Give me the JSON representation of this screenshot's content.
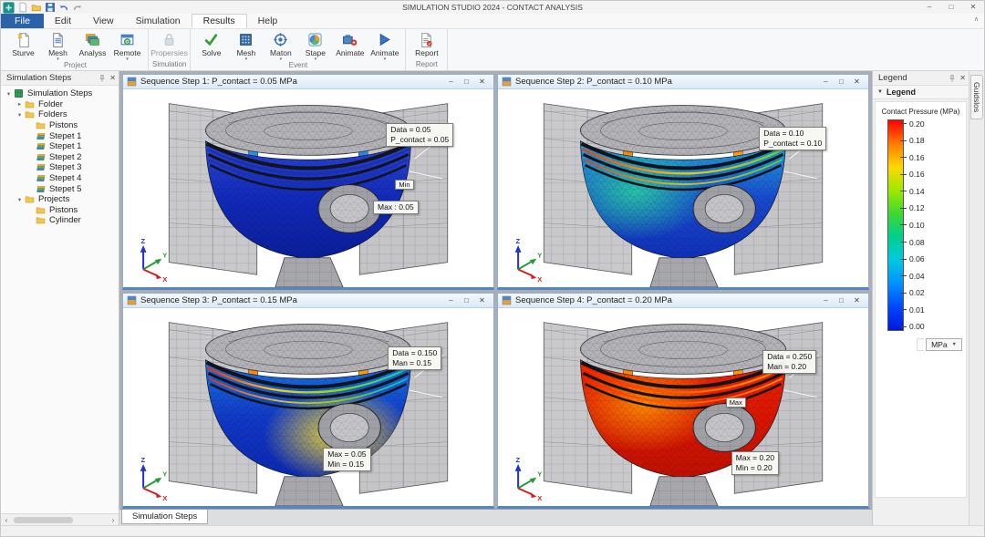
{
  "titlebar": {
    "title": "SIMULATION STUDIO 2024 - CONTACT ANALYSIS",
    "controls": {
      "minimize": "–",
      "maximize": "□",
      "close": "✕"
    },
    "ribbon_collapse": "∧",
    "quick_access": [
      "new",
      "open",
      "save",
      "undo",
      "redo"
    ]
  },
  "menubar": {
    "items": [
      {
        "label": "File"
      },
      {
        "label": "Edit"
      },
      {
        "label": "View"
      },
      {
        "label": "Simulation"
      },
      {
        "label": "Results"
      },
      {
        "label": "Help"
      }
    ],
    "active": "Results"
  },
  "ribbon": {
    "groups": [
      {
        "label": "Project",
        "buttons": [
          {
            "label": "Sturve",
            "icon": "doc-new",
            "dropdown": false
          },
          {
            "label": "Mesh",
            "icon": "doc-mesh",
            "dropdown": true
          },
          {
            "label": "Analyss",
            "icon": "layers",
            "dropdown": false
          },
          {
            "label": "Remote",
            "icon": "window-gear",
            "dropdown": true
          }
        ]
      },
      {
        "label": "Simulation",
        "buttons": [
          {
            "label": "Propersies",
            "icon": "lock",
            "disabled": true
          }
        ]
      },
      {
        "label": "Event",
        "buttons": [
          {
            "label": "Solve",
            "icon": "check"
          },
          {
            "label": "Mesh",
            "icon": "grid",
            "dropdown": true
          },
          {
            "label": "Maton",
            "icon": "target",
            "dropdown": true
          },
          {
            "label": "Stape",
            "icon": "pinwheel",
            "dropdown": true
          },
          {
            "label": "Animate",
            "icon": "machine"
          },
          {
            "label": "Animate",
            "icon": "play",
            "dropdown": true
          }
        ]
      },
      {
        "label": "Report",
        "buttons": [
          {
            "label": "Report",
            "icon": "report"
          }
        ]
      }
    ]
  },
  "sidebar": {
    "title": "Simulation Steps",
    "tree": [
      {
        "label": "Simulation Steps",
        "depth": 0,
        "icon": "root",
        "chev": "open"
      },
      {
        "label": "Folder",
        "depth": 1,
        "icon": "folder",
        "chev": "closed"
      },
      {
        "label": "Folders",
        "depth": 1,
        "icon": "folder",
        "chev": "open"
      },
      {
        "label": "Pistons",
        "depth": 2,
        "icon": "folder",
        "chev": "none"
      },
      {
        "label": "Stepet 1",
        "depth": 2,
        "icon": "step",
        "chev": "none"
      },
      {
        "label": "Stepet 1",
        "depth": 2,
        "icon": "step",
        "chev": "none"
      },
      {
        "label": "Stepet 2",
        "depth": 2,
        "icon": "step",
        "chev": "none"
      },
      {
        "label": "Stepet 3",
        "depth": 2,
        "icon": "step",
        "chev": "none"
      },
      {
        "label": "Stepet 4",
        "depth": 2,
        "icon": "step",
        "chev": "none"
      },
      {
        "label": "Stepet 5",
        "depth": 2,
        "icon": "step",
        "chev": "none"
      },
      {
        "label": "Projects",
        "depth": 1,
        "icon": "folder",
        "chev": "open"
      },
      {
        "label": "Pistons",
        "depth": 2,
        "icon": "folder",
        "chev": "none"
      },
      {
        "label": "Cylinder",
        "depth": 2,
        "icon": "folder",
        "chev": "none"
      }
    ]
  },
  "viewports": [
    {
      "title": "Sequence Step 1: P_contact = 0.05 MPa",
      "annotations": {
        "data1": "Data = 0.05",
        "data2": "P_contact = 0.05",
        "mini": "Min",
        "max1": "Max : 0.05"
      },
      "colors": {
        "strip": [
          "#35b9ef",
          "#1243e4",
          "#0a2ac0"
        ],
        "rings": [
          "#1a2fae"
        ],
        "body": [
          "#2b46d6",
          "#1129ba",
          "#0a1e9a"
        ],
        "glow": null
      }
    },
    {
      "title": "Sequence Step 2: P_contact = 0.10 MPa",
      "annotations": {
        "data1": "Data = 0.10",
        "data2": "P_contact = 0.10"
      },
      "colors": {
        "strip": [
          "#ff3300",
          "#ffd000",
          "#2fc83a",
          "#1140e0"
        ],
        "rings": [
          "#ff3300",
          "#ffc400",
          "#62d822"
        ],
        "body": [
          "#23a9d9",
          "#1848d0",
          "#1030b8"
        ],
        "glow": "#27c9a4"
      }
    },
    {
      "title": "Sequence Step 3: P_contact = 0.15 MPa",
      "annotations": {
        "data1": "Data = 0.150",
        "data2": "Man = 0.15",
        "max1": "Max = 0.05",
        "max2": "Min = 0.15"
      },
      "colors": {
        "strip": [
          "#ff3300",
          "#ffd000",
          "#2fc83a",
          "#1140e0"
        ],
        "rings": [
          "#ff2200",
          "#ffcc00",
          "#7fe000",
          "#00c8c8"
        ],
        "body": [
          "#1a78e0",
          "#1038c8",
          "#0c28b0"
        ],
        "glow": "#ffe02c"
      }
    },
    {
      "title": "Sequence Step 4: P_contact = 0.20 MPa",
      "annotations": {
        "data1": "Data = 0.250",
        "data2": "Man = 0.20",
        "mini": "Max",
        "max1": "Max = 0.20",
        "max2": "Min = 0.20"
      },
      "colors": {
        "strip": [
          "#ff3300",
          "#ffd000",
          "#2fc83a",
          "#1140e0"
        ],
        "rings": [
          "#ff2200",
          "#ff9a00"
        ],
        "body": [
          "#f12300",
          "#da1500",
          "#c11000"
        ],
        "glow": "#ff8c00"
      }
    }
  ],
  "axes": {
    "x": "X",
    "y": "Y",
    "z": "Z"
  },
  "legend": {
    "panel_title": "Legend",
    "section_title": "Legend",
    "field_label": "Contact Pressure (MPa)",
    "ticks": [
      "0.20",
      "0.18",
      "0.16",
      "0.16",
      "0.14",
      "0.12",
      "0.10",
      "0.08",
      "0.06",
      "0.04",
      "0.02",
      "0.01",
      "0.00"
    ],
    "unit": "MPa",
    "colorbar": [
      "#ff0000",
      "#ff7a00",
      "#ffd800",
      "#9fe800",
      "#3fd830",
      "#00cf8f",
      "#00c9e0",
      "#0092ff",
      "#0047ff",
      "#0019d8"
    ]
  },
  "right_tab": "Guidslos",
  "bottom_tab": "Simulation Steps"
}
